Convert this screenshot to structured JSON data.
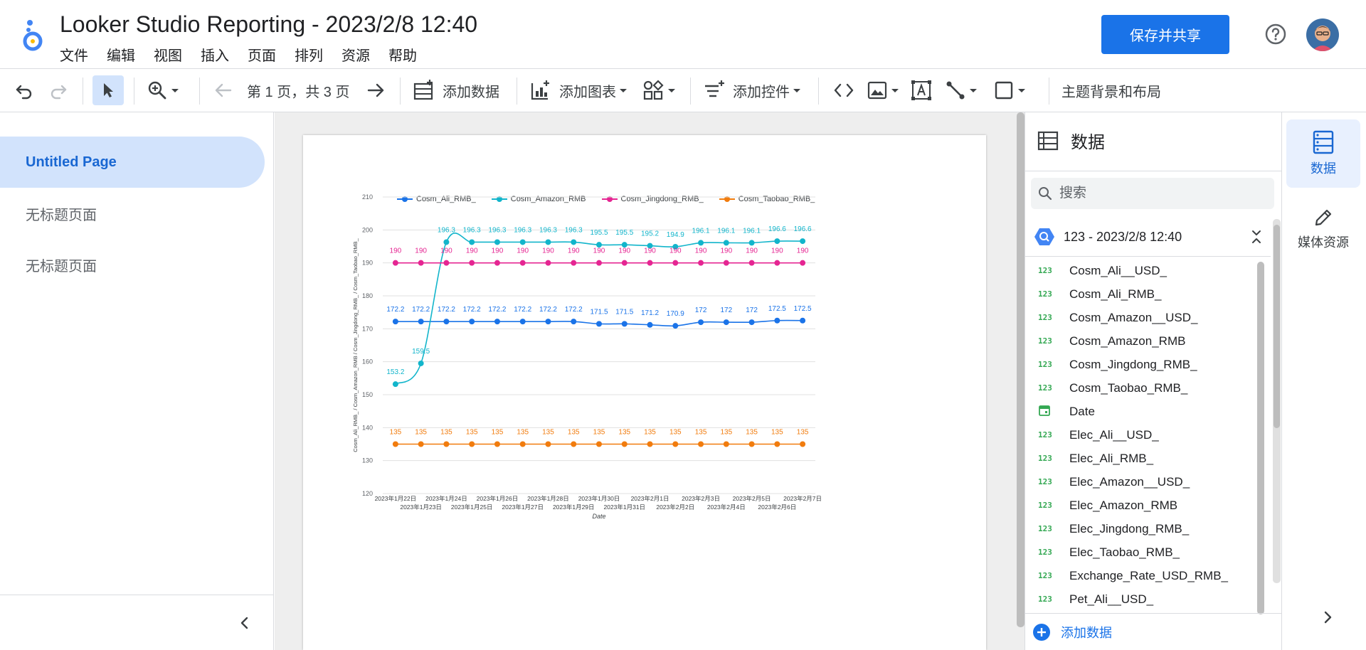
{
  "header": {
    "title": "Looker Studio Reporting - 2023/2/8 12:40",
    "menu": [
      "文件",
      "编辑",
      "视图",
      "插入",
      "页面",
      "排列",
      "资源",
      "帮助"
    ],
    "share_label": "保存并共享"
  },
  "toolbar": {
    "pagination": "第 1 页，共 3 页",
    "add_data": "添加数据",
    "add_chart": "添加图表",
    "add_control": "添加控件",
    "theme_layout": "主题背景和布局"
  },
  "pages": {
    "items": [
      {
        "label": "Untitled Page"
      },
      {
        "label": "无标题页面"
      },
      {
        "label": "无标题页面"
      }
    ]
  },
  "data_panel": {
    "title": "数据",
    "search_placeholder": "搜索",
    "source_name": "123 - 2023/2/8 12:40",
    "fields": [
      {
        "type": "123",
        "name": "Cosm_Ali__USD_"
      },
      {
        "type": "123",
        "name": "Cosm_Ali_RMB_"
      },
      {
        "type": "123",
        "name": "Cosm_Amazon__USD_"
      },
      {
        "type": "123",
        "name": "Cosm_Amazon_RMB"
      },
      {
        "type": "123",
        "name": "Cosm_Jingdong_RMB_"
      },
      {
        "type": "123",
        "name": "Cosm_Taobao_RMB_"
      },
      {
        "type": "date",
        "name": "Date"
      },
      {
        "type": "123",
        "name": "Elec_Ali__USD_"
      },
      {
        "type": "123",
        "name": "Elec_Ali_RMB_"
      },
      {
        "type": "123",
        "name": "Elec_Amazon__USD_"
      },
      {
        "type": "123",
        "name": "Elec_Amazon_RMB"
      },
      {
        "type": "123",
        "name": "Elec_Jingdong_RMB_"
      },
      {
        "type": "123",
        "name": "Elec_Taobao_RMB_"
      },
      {
        "type": "123",
        "name": "Exchange_Rate_USD_RMB_"
      },
      {
        "type": "123",
        "name": "Pet_Ali__USD_"
      }
    ],
    "add_data_label": "添加数据"
  },
  "right_rail": {
    "data_label": "数据",
    "media_label": "媒体资源"
  },
  "chart_data": {
    "type": "line",
    "xlabel": "Date",
    "ylabel": "Cosm_Ali_RMB_ / Cosm_Amazon_RMB / Cosm_Jingdong_RMB_ / Cosm_Taobao_RMB_",
    "ylim": [
      120,
      210
    ],
    "yticks": [
      120,
      130,
      140,
      150,
      160,
      170,
      180,
      190,
      200,
      210
    ],
    "grid": true,
    "legend_position": "top-left",
    "x": [
      "2023年1月22日",
      "2023年1月23日",
      "2023年1月24日",
      "2023年1月25日",
      "2023年1月26日",
      "2023年1月27日",
      "2023年1月28日",
      "2023年1月29日",
      "2023年1月30日",
      "2023年1月31日",
      "2023年2月1日",
      "2023年2月2日",
      "2023年2月3日",
      "2023年2月4日",
      "2023年2月5日",
      "2023年2月6日",
      "2023年2月7日"
    ],
    "series": [
      {
        "name": "Cosm_Ali_RMB_",
        "color": "#1a73e8",
        "values": [
          172.2,
          172.2,
          172.2,
          172.2,
          172.2,
          172.2,
          172.2,
          172.2,
          171.5,
          171.5,
          171.2,
          170.9,
          172,
          172,
          172,
          172.5,
          172.5
        ]
      },
      {
        "name": "Cosm_Amazon_RMB",
        "color": "#12b5cb",
        "values": [
          153.2,
          159.5,
          196.3,
          196.3,
          196.3,
          196.3,
          196.3,
          196.3,
          195.5,
          195.5,
          195.2,
          194.9,
          196.1,
          196.1,
          196.1,
          196.6,
          196.6
        ]
      },
      {
        "name": "Cosm_Jingdong_RMB_",
        "color": "#e52592",
        "values": [
          190,
          190,
          190,
          190,
          190,
          190,
          190,
          190,
          190,
          190,
          190,
          190,
          190,
          190,
          190,
          190,
          190
        ]
      },
      {
        "name": "Cosm_Taobao_RMB_",
        "color": "#f17c0e",
        "values": [
          135,
          135,
          135,
          135,
          135,
          135,
          135,
          135,
          135,
          135,
          135,
          135,
          135,
          135,
          135,
          135,
          135
        ]
      }
    ]
  }
}
